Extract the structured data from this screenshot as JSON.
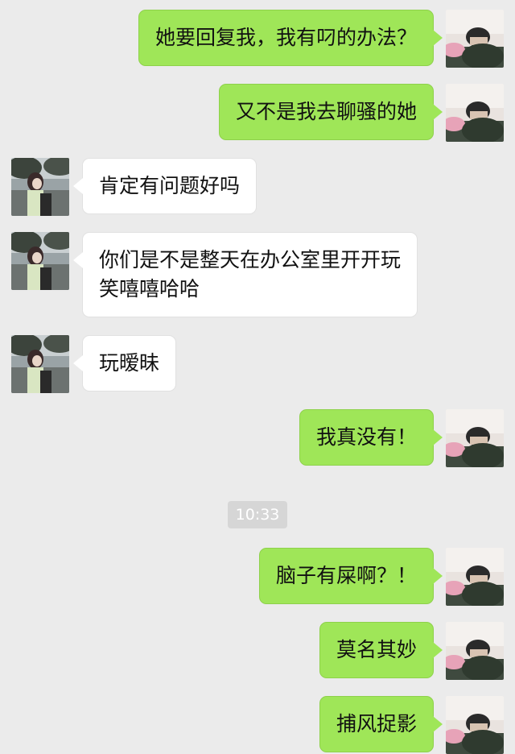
{
  "chat": {
    "messages": [
      {
        "side": "right",
        "text": "她要回复我，我有叼的办法？"
      },
      {
        "side": "right",
        "text": "又不是我去聊骚的她"
      },
      {
        "side": "left",
        "text": "肯定有问题好吗"
      },
      {
        "side": "left",
        "text_line1": "你们是不是整天在办公室里开开玩",
        "text_line2": "笑嘻嘻哈哈"
      },
      {
        "side": "left",
        "text": "玩暧昧"
      },
      {
        "side": "right",
        "text": "我真没有！"
      },
      {
        "side": "right",
        "text": "脑子有屎啊？！"
      },
      {
        "side": "right",
        "text": "莫名其妙"
      },
      {
        "side": "right",
        "text": "捕风捉影"
      }
    ],
    "timestamp": "10:33"
  },
  "colors": {
    "background": "#ebebeb",
    "outgoing_bubble": "#9fe658",
    "incoming_bubble": "#ffffff"
  }
}
